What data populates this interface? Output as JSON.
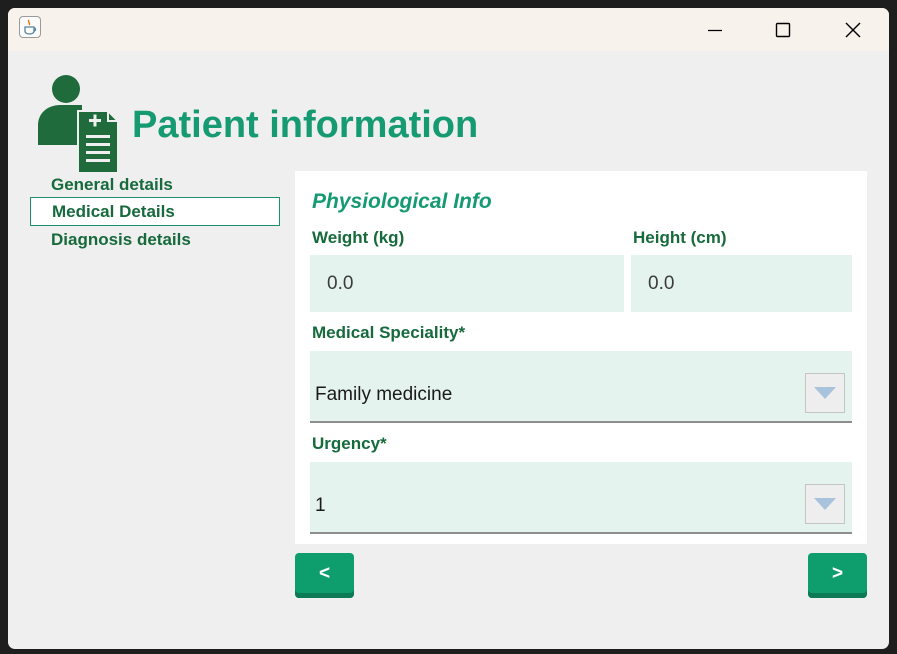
{
  "window": {
    "app_icon": "java-cup-icon",
    "controls": [
      "minimize-icon",
      "maximize-icon",
      "close-icon"
    ]
  },
  "header": {
    "icon": "patient-record-icon",
    "title": "Patient information"
  },
  "sidebar": {
    "items": [
      {
        "label": "General details",
        "selected": false
      },
      {
        "label": "Medical Details",
        "selected": true
      },
      {
        "label": "Diagnosis details",
        "selected": false
      }
    ]
  },
  "form": {
    "section_title": "Physiological Info",
    "weight": {
      "label": "Weight (kg)",
      "value": "0.0"
    },
    "height": {
      "label": "Height (cm)",
      "value": "0.0"
    },
    "speciality": {
      "label": "Medical Speciality*",
      "value": "Family medicine"
    },
    "urgency": {
      "label": "Urgency*",
      "value": "1"
    }
  },
  "buttons": {
    "back_label": "<",
    "next_label": ">"
  },
  "colors": {
    "accent": "#159a72",
    "label": "#166a3c",
    "field_bg": "#e5f3ef",
    "button": "#0e9e6e"
  }
}
